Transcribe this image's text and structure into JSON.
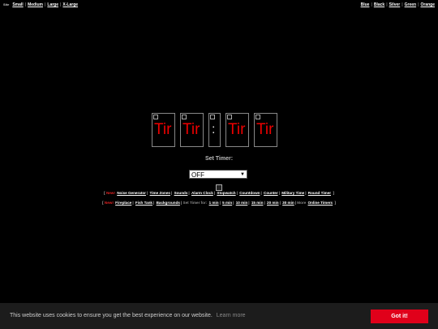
{
  "topbar": {
    "logo_alt": "Site",
    "sizes": [
      "Small",
      "Medium",
      "Large",
      "X-Large"
    ],
    "colors": [
      "Blue",
      "Black",
      "Silver",
      "Green",
      "Orange"
    ]
  },
  "clock": {
    "digit_alt": "Tir",
    "colon_alt": ":"
  },
  "set_timer": {
    "label": "Set Timer:",
    "selected": "OFF"
  },
  "nav1": {
    "new_label": "New!",
    "links": [
      "Noise Generator",
      "Time Zones",
      "Sounds",
      "Alarm Clock",
      "Stopwatch",
      "Countdown",
      "Counter",
      "Military Time",
      "Round Timer"
    ]
  },
  "nav2": {
    "new_label": "New!",
    "links": [
      "Fireplace",
      "Fish Tank",
      "Backgrounds"
    ],
    "set_timer_for": "Set Timer for:",
    "timer_links": [
      "1 min",
      "5 min",
      "10 min",
      "15 min",
      "20 min",
      "30 min"
    ],
    "more_label": "More",
    "more_link": "Online Timers"
  },
  "cookie": {
    "message": "This website uses cookies to ensure you get the best experience on our website.",
    "learn_more": "Learn more",
    "accept": "Got it!"
  },
  "colors": {
    "accent": "#e0001a",
    "background": "#000000"
  }
}
